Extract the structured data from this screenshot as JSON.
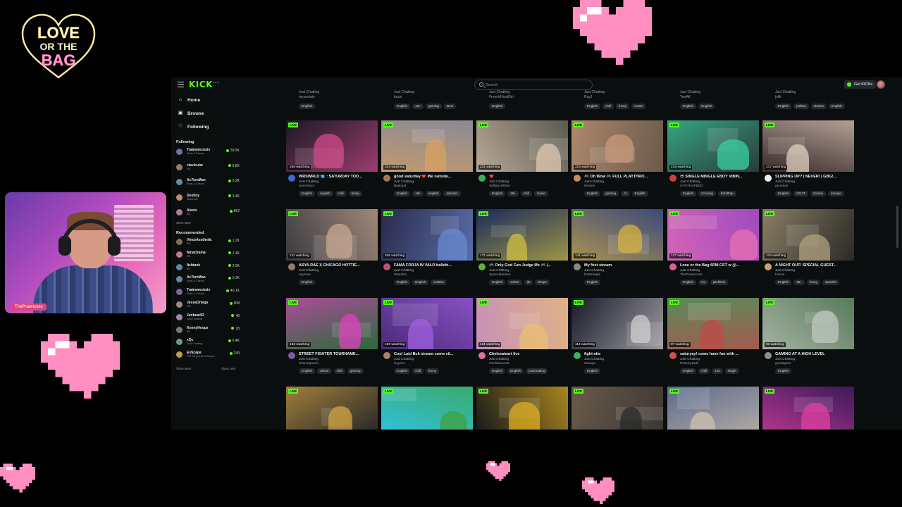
{
  "overlay": {
    "logo_lines": [
      "LOVE",
      "OR THE",
      "BAG"
    ],
    "cam_name": "ThePrawncess"
  },
  "colors": {
    "kick_green": "#53fc18",
    "heart_pink": "#ff8fc0",
    "bg": "#0b0e0f"
  },
  "topbar": {
    "logo": "KICK",
    "search_placeholder": "Search",
    "get_kicks": "Get KICKs"
  },
  "sidebar": {
    "nav": [
      {
        "label": "Home",
        "icon": "home-icon"
      },
      {
        "label": "Browse",
        "icon": "browse-icon"
      },
      {
        "label": "Following",
        "icon": "heart-icon"
      }
    ],
    "following_heading": "Following",
    "following": [
      {
        "name": "Trainwreckstv",
        "category": "Slots & Casino",
        "viewers": "39.5K",
        "color": "#7a6a9a"
      },
      {
        "name": "clavicular",
        "category": "IRL",
        "viewers": "8.8K",
        "color": "#9a7a6a"
      },
      {
        "name": "Ac7ionMan",
        "category": "Slots & Casino",
        "viewers": "5.2K",
        "color": "#6a8a9a"
      },
      {
        "name": "Destiny",
        "category": "Minecraft",
        "viewers": "3.4K",
        "color": "#c08a6a"
      },
      {
        "name": "Alexis",
        "category": "IRL",
        "viewers": "852",
        "color": "#b07a9a"
      }
    ],
    "show_more_1": "Show More",
    "recommended_heading": "Recommended",
    "recommended": [
      {
        "name": "VinceAesthetic",
        "category": "IRL",
        "viewers": "1.2K",
        "color": "#8a6a5a"
      },
      {
        "name": "NinaOrama",
        "category": "IRL",
        "viewers": "1.4K",
        "color": "#c07a8a"
      },
      {
        "name": "fishtank",
        "category": "IRL",
        "viewers": "2.9K",
        "color": "#5a8aaa"
      },
      {
        "name": "Ac7ionMan",
        "category": "Slots & Casino",
        "viewers": "5.3K",
        "color": "#6a8a9a"
      },
      {
        "name": "Trainwreckstv",
        "category": "Slots & Casino",
        "viewers": "40.1K",
        "color": "#7a6a9a"
      },
      {
        "name": "JessaOrtega",
        "category": "IRL",
        "viewers": "508",
        "color": "#a08a7a"
      },
      {
        "name": "Jenbear92",
        "category": "Just Chatting",
        "viewers": "49",
        "color": "#9a8aaa"
      },
      {
        "name": "KennyHoopz",
        "category": "IRL",
        "viewers": "18",
        "color": "#7a7a7a"
      },
      {
        "name": "xQc",
        "category": "Just Chatting",
        "viewers": "6.4K",
        "color": "#6a9a8a"
      },
      {
        "name": "EvScape",
        "category": "Old School RuneScape",
        "viewers": "249",
        "color": "#c0a040"
      }
    ],
    "show_more_2": "Show More",
    "show_less": "Show Less"
  },
  "top_row_partial": [
    {
      "category": "Just Chatting",
      "user": "myreshatv",
      "tags": [
        "English"
      ]
    },
    {
      "category": "Just Chatting",
      "user": "kozzi",
      "tags": [
        "English",
        "18+",
        "gaming",
        "BAU"
      ]
    },
    {
      "category": "Just Chatting",
      "user": "FrenchFriedGirl",
      "tags": [
        "English"
      ]
    },
    {
      "category": "Just Chatting",
      "user": "RayJ",
      "tags": [
        "English",
        "chill",
        "funny",
        "music"
      ]
    },
    {
      "category": "Just Chatting",
      "user": "YeoAK",
      "tags": [
        "English",
        "English"
      ]
    },
    {
      "category": "Just Chatting",
      "user": "jstlk",
      "tags": [
        "English",
        "politics",
        "Drama",
        "English"
      ]
    }
  ],
  "streams": [
    {
      "live": "LIVE",
      "watching": "256 watching",
      "title": "WRSWRLD 🌎 : SATURDAY TOD...",
      "category": "Just Chatting",
      "user": "wurzelroot",
      "tags": [
        "English",
        "english",
        "chill",
        "funny"
      ],
      "bg": "#1a1a24",
      "accent": "#d04a8a",
      "avatar": "#3a6ad0"
    },
    {
      "live": "LIVE",
      "watching": "234 watching",
      "title": "good saturday ❤️ We outside...",
      "category": "Just Chatting",
      "user": "Bigloaaf",
      "tags": [
        "English",
        "18+",
        "english",
        "adresss"
      ],
      "bg": "#8a8a94",
      "accent": "#d8a060",
      "avatar": "#a07a5a"
    },
    {
      "live": "LIVE",
      "watching": "231 watching",
      "title": "❤️",
      "category": "Just Chatting",
      "user": "WilliamJWhite",
      "tags": [
        "English",
        "18+",
        "chill",
        "music"
      ],
      "bg": "#5a5a52",
      "accent": "#e0c8b0",
      "avatar": "#3ab060"
    },
    {
      "live": "LIVE",
      "watching": "224 watching",
      "title": "🎮 Oh Wow 🎮 FULL PLAYTHRO...",
      "category": "Just Chatting",
      "user": "Moises",
      "tags": [
        "English",
        "gaming",
        "AI",
        "English"
      ],
      "bg": "#6a5a4a",
      "accent": "#c89a7a",
      "avatar": "#c09060"
    },
    {
      "live": "LIVE",
      "watching": "218 watching",
      "title": "😎 SINGLE MINGLE EBOY VIBIN...",
      "category": "Just Chatting",
      "user": "SYNTHSPEED",
      "tags": [
        "English",
        "Cruising",
        "thirsttrap"
      ],
      "bg": "#2a3a3a",
      "accent": "#3ad0a0",
      "avatar": "#d04040"
    },
    {
      "live": "LIVE",
      "watching": "217 watching",
      "title": "SLIPPING UP? | NEVER! | GBG!...",
      "category": "Just Chatting",
      "user": "gsrantos",
      "tags": [
        "English",
        "GOAT",
        "Somali",
        "escape"
      ],
      "bg": "#3a2a2a",
      "accent": "#e0d0c0",
      "avatar": "#eeeeee"
    },
    {
      "live": "LIVE",
      "watching": "211 watching",
      "title": "ASYA RAE X CHICAGO HOTTIE...",
      "category": "Just Chatting",
      "user": "asyarae",
      "tags": [
        "English"
      ],
      "bg": "#3a3a40",
      "accent": "#c8a890",
      "avatar": "#9a7a6a"
    },
    {
      "live": "LIVE",
      "watching": "206 watching",
      "title": "FAMA FORJA W VALO ba9chi...",
      "category": "Just Chatting",
      "user": "Maaabtx",
      "tags": [
        "English",
        "English",
        "arabbic"
      ],
      "bg": "#2a2a4a",
      "accent": "#6a8ad0",
      "avatar": "#c05070"
    },
    {
      "live": "LIVE",
      "watching": "171 watching",
      "title": "🎮 Only God Can Judge Me 🎮 |...",
      "category": "Just Chatting",
      "user": "SpaceMonkee",
      "tags": [
        "English",
        "vtuber",
        "its",
        "Drops"
      ],
      "bg": "#1a2a5a",
      "accent": "#d0c040",
      "avatar": "#60b040"
    },
    {
      "live": "LIVE",
      "watching": "141 watching",
      "title": "My first stream.",
      "category": "Just Chatting",
      "user": "Destrangis",
      "tags": [
        "English"
      ],
      "bg": "#3a4a7a",
      "accent": "#d8b040",
      "avatar": "#888888"
    },
    {
      "live": "LIVE",
      "watching": "137 watching",
      "title": "Love or the Bag 6PM CST w @...",
      "category": "Just Chatting",
      "user": "ThePrawncess",
      "tags": [
        "English",
        "Cx",
        "pitchkick"
      ],
      "bg": "#a04ac0",
      "accent": "#e870b0",
      "avatar": "#e06090"
    },
    {
      "live": "LIVE",
      "watching": "134 watching",
      "title": "A NIGHT OUT! SPECIAL GUEST...",
      "category": "Just Chatting",
      "user": "Fanos",
      "tags": [
        "English",
        "18+",
        "funny",
        "spanish"
      ],
      "bg": "#2a2a26",
      "accent": "#b0a080",
      "avatar": "#d0a070"
    },
    {
      "live": "LIVE",
      "watching": "133 watching",
      "title": "STREET FIGHTER TOURNAME...",
      "category": "Just Chatting",
      "user": "KitanaQueen",
      "tags": [
        "English",
        "anime",
        "chill",
        "gaming"
      ],
      "bg": "#2a6a3a",
      "accent": "#e040c0",
      "avatar": "#7a5aa0"
    },
    {
      "live": "LIVE",
      "watching": "130 watching",
      "title": "Cool Laid Bck stream come vil...",
      "category": "Just Chatting",
      "user": "HyyJoe",
      "tags": [
        "English",
        "chill",
        "funny"
      ],
      "bg": "#4a2a7a",
      "accent": "#a060e0",
      "avatar": "#b08060"
    },
    {
      "live": "LIVE",
      "watching": "121 watching",
      "title": "Chelseaieart live",
      "category": "Just Chatting",
      "user": "ChelseaLeart",
      "tags": [
        "English",
        "English",
        "justchatting"
      ],
      "bg": "#c890b8",
      "accent": "#e8c070",
      "avatar": "#e070a0"
    },
    {
      "live": "LIVE",
      "watching": "114 watching",
      "title": "fight nite",
      "category": "Just Chatting",
      "user": "zbanga",
      "tags": [
        "English"
      ],
      "bg": "#1a1a2a",
      "accent": "#d0d0d0",
      "avatar": "#40b060"
    },
    {
      "live": "LIVE",
      "watching": "97 watching",
      "title": "saturyay! come have fun with ...",
      "category": "Just Chatting",
      "user": "PeachyJade",
      "tags": [
        "English",
        "chill",
        "420",
        "single"
      ],
      "bg": "#5a8a5a",
      "accent": "#c04a4a",
      "avatar": "#d05050"
    },
    {
      "live": "LIVE",
      "watching": "93 watching",
      "title": "GAMING AT A HIGH LEVEL",
      "category": "Just Chatting",
      "user": "greekgodx",
      "tags": [
        "English"
      ],
      "bg": "#5a7a5a",
      "accent": "#c0c8c0",
      "avatar": "#909090"
    }
  ],
  "bottom_row": [
    {
      "live": "LIVE",
      "bg": "#2a2a2a",
      "accent": "#d0a040"
    },
    {
      "live": "LIVE",
      "bg": "#30c0d8",
      "accent": "#40a040"
    },
    {
      "live": "LIVE",
      "bg": "#1a1a1a",
      "accent": "#e0b020"
    },
    {
      "live": "LIVE",
      "bg": "#6a5a4a",
      "accent": "#2a2a2a"
    },
    {
      "live": "LIVE",
      "bg": "#5a6a8a",
      "accent": "#d0c0b0"
    },
    {
      "live": "LIVE",
      "bg": "#3a1a5a",
      "accent": "#e040a0"
    }
  ]
}
